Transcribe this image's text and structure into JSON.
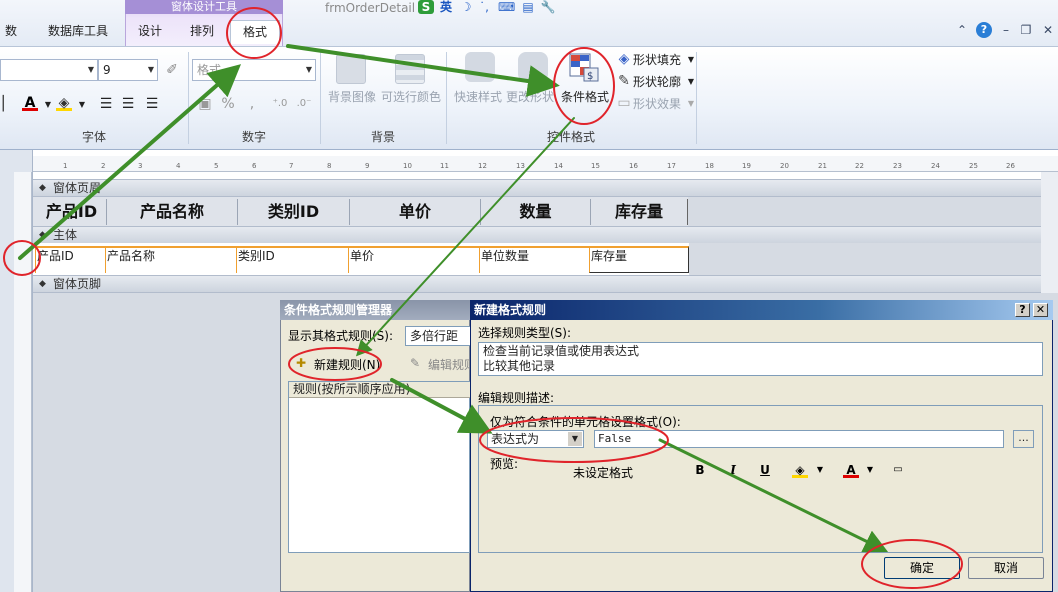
{
  "tabs": {
    "context_group": "窗体设计工具",
    "items": [
      "数据",
      "数据库工具",
      "设计",
      "排列",
      "格式"
    ],
    "window_title": "frmOrderDetail",
    "ime_label": "英"
  },
  "ribbon": {
    "font_size": "9",
    "format_placeholder": "格式",
    "percent": "%",
    "comma": ",",
    "bg_image": "背景图像",
    "alt_color": "可选行颜色",
    "quick_style": "快速样式",
    "change_shape": "更改形状",
    "conditional_format": "条件格式",
    "shape_fill": "形状填充",
    "shape_outline": "形状轮廓",
    "shape_effect": "形状效果",
    "groups": {
      "font": "字体",
      "number": "数字",
      "background": "背景",
      "control_format": "控件格式"
    }
  },
  "form": {
    "header_section": "窗体页眉",
    "detail_section": "主体",
    "footer_section": "窗体页脚",
    "header_labels": [
      "产品ID",
      "产品名称",
      "类别ID",
      "单价",
      "数量",
      "库存量"
    ],
    "detail_fields": [
      "产品ID",
      "产品名称",
      "类别ID",
      "单价",
      "单位数量",
      "库存量"
    ],
    "ruler": [
      "1",
      "2",
      "3",
      "4",
      "5",
      "6",
      "7",
      "8",
      "9",
      "10",
      "11",
      "12",
      "13",
      "14",
      "15",
      "16",
      "17",
      "18",
      "19",
      "20",
      "21",
      "22",
      "23",
      "24",
      "25",
      "26"
    ]
  },
  "manager": {
    "title": "条件格式规则管理器",
    "show_rules_label": "显示其格式规则(S):",
    "show_rules_value": "多倍行距",
    "new_rule": "新建规则(N)",
    "edit_rule": "编辑规则",
    "rules_header": "规则(按所示顺序应用)"
  },
  "newrule": {
    "title": "新建格式规则",
    "help": "?",
    "close": "✕",
    "select_type_label": "选择规则类型(S):",
    "rule_types": [
      "检查当前记录值或使用表达式",
      "比较其他记录"
    ],
    "edit_desc_label": "编辑规则描述:",
    "only_format_label": "仅为符合条件的单元格设置格式(O):",
    "condition_type": "表达式为",
    "expression": "False",
    "browse": "...",
    "preview_label": "预览:",
    "preview_text": "未设定格式",
    "bold": "B",
    "italic": "I",
    "underline": "U",
    "font_color_glyph": "A",
    "ok": "确定",
    "cancel": "取消"
  },
  "colors": {
    "accent_arrow": "#3f8f2a",
    "highlight_circle": "#e0242b",
    "field_border": "#f0a030"
  }
}
